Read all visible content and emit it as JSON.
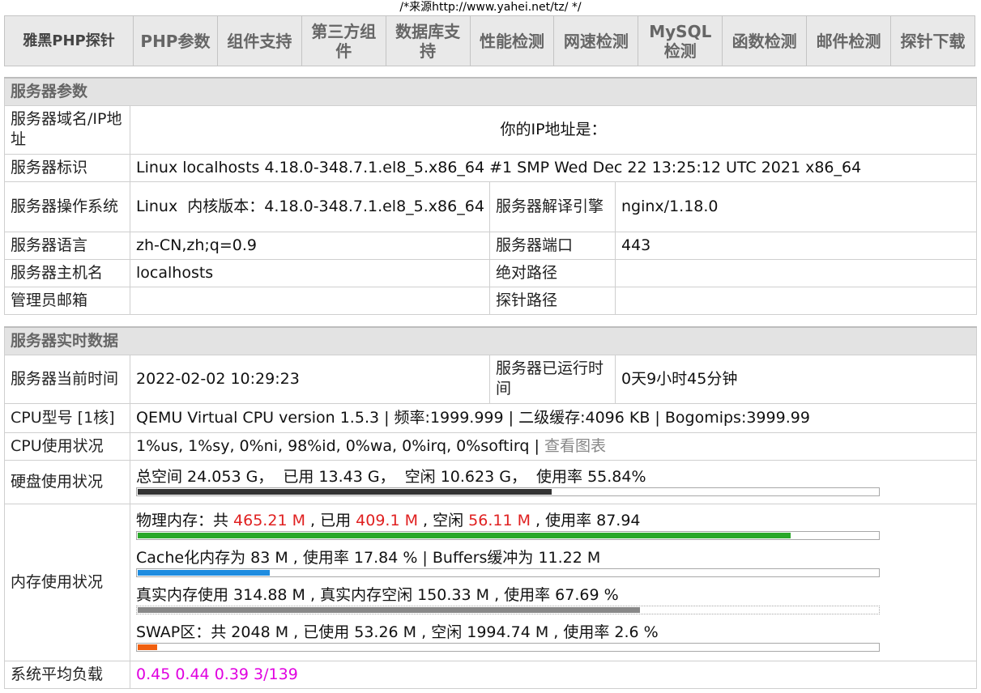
{
  "source_comment": "/*来源http://www.yahei.net/tz/ */",
  "nav": {
    "brand": "雅黑PHP探针",
    "items": [
      "PHP参数",
      "组件支持",
      "第三方组件",
      "数据库支持",
      "性能检测",
      "网速检测",
      "MySQL检测",
      "函数检测",
      "邮件检测",
      "探针下载"
    ]
  },
  "server_params": {
    "title": "服务器参数",
    "domain_label": "服务器域名/IP地址",
    "domain_value": "你的IP地址是：",
    "identity_label": "服务器标识",
    "identity_value": "Linux localhosts 4.18.0-348.7.1.el8_5.x86_64 #1 SMP Wed Dec 22 13:25:12 UTC 2021 x86_64",
    "os_label": "服务器操作系统",
    "os_value": "Linux  内核版本：4.18.0-348.7.1.el8_5.x86_64",
    "engine_label": "服务器解译引擎",
    "engine_value": "nginx/1.18.0",
    "lang_label": "服务器语言",
    "lang_value": "zh-CN,zh;q=0.9",
    "port_label": "服务器端口",
    "port_value": "443",
    "host_label": "服务器主机名",
    "host_value": "localhosts",
    "abs_path_label": "绝对路径",
    "abs_path_value": "",
    "admin_label": "管理员邮箱",
    "admin_value": "",
    "probe_path_label": "探针路径",
    "probe_path_value": ""
  },
  "realtime": {
    "title": "服务器实时数据",
    "time_label": "服务器当前时间",
    "time_value": "2022-02-02 10:29:23",
    "uptime_label": "服务器已运行时间",
    "uptime_value": "0天9小时45分钟",
    "cpu_model_label": "CPU型号 [1核]",
    "cpu_model_value": "QEMU Virtual CPU version 1.5.3 | 频率:1999.999 | 二级缓存:4096 KB | Bogomips:3999.99",
    "cpu_usage_label": "CPU使用状况",
    "cpu_usage_value": "1%us, 1%sy, 0%ni, 98%id, 0%wa, 0%irq, 0%softirq | ",
    "cpu_chart_link": "查看图表",
    "disk_label": "硬盘使用状况",
    "disk": {
      "total_prefix": "总空间 ",
      "total": "24.053",
      "used_prefix": " G，  已用 ",
      "used": "13.43",
      "free_prefix": " G，  空闲 ",
      "free": "10.623",
      "pct_prefix": " G，  使用率 ",
      "pct": "55.84%",
      "fraction": 0.5584,
      "color": "#333333"
    },
    "mem_label": "内存使用状况",
    "mem": {
      "physical": {
        "p1": "物理内存：共 ",
        "total": "465.21 M",
        "p2": " , 已用 ",
        "used": "409.1 M",
        "p3": " , 空闲 ",
        "free": "56.11 M",
        "p4": " , 使用率 87.94",
        "fraction": 0.8794,
        "color": "#2aa82a"
      },
      "cache": {
        "text": "Cache化内存为 83 M , 使用率 17.84 % | Buffers缓冲为 11.22 M",
        "fraction": 0.1784,
        "color": "#1e8ce0"
      },
      "real": {
        "text": "真实内存使用 314.88 M , 真实内存空闲 150.33 M , 使用率 67.69 %",
        "fraction": 0.6769,
        "color": "#888888"
      },
      "swap": {
        "text": "SWAP区：共 2048 M , 已使用 53.26 M , 空闲 1994.74 M , 使用率 2.6 %",
        "fraction": 0.026,
        "color": "#f06010"
      }
    },
    "load_label": "系统平均负载",
    "load_value": "0.45 0.44 0.39 3/139"
  }
}
